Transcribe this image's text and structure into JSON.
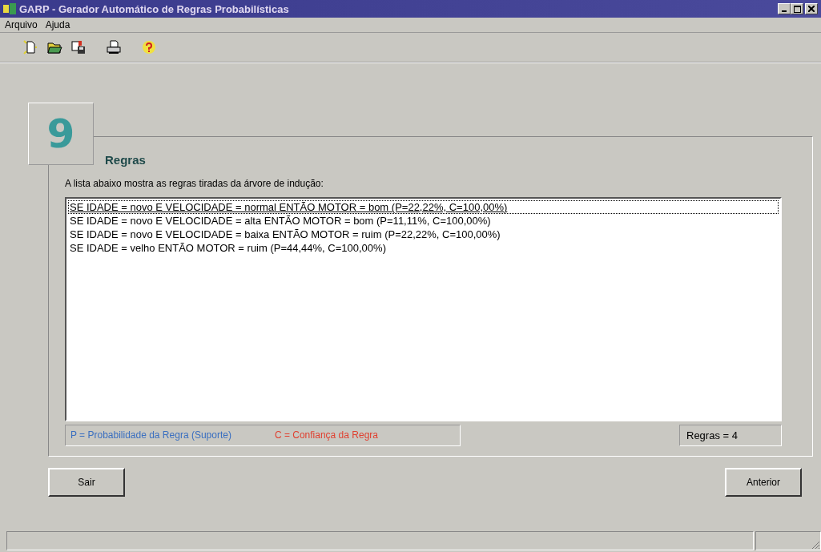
{
  "window": {
    "title": "GARP - Gerador Automático de Regras Probabilísticas"
  },
  "menu": [
    "Arquivo",
    "Ajuda"
  ],
  "step": {
    "number": "9",
    "title": "Regras",
    "description": "A lista abaixo mostra as regras tiradas da árvore de indução:"
  },
  "rules": [
    {
      "text": "SE IDADE = novo E VELOCIDADE = normal ENTÃO MOTOR = bom (P=22,22%,  C=100,00%)",
      "selected": true
    },
    {
      "text": "SE IDADE = novo E VELOCIDADE = alta ENTÃO MOTOR = bom (P=11,11%,  C=100,00%)",
      "selected": false
    },
    {
      "text": "SE IDADE = novo E VELOCIDADE = baixa ENTÃO MOTOR = ruim (P=22,22%,  C=100,00%)",
      "selected": false
    },
    {
      "text": "SE IDADE = velho ENTÃO MOTOR = ruim (P=44,44%,  C=100,00%)",
      "selected": false
    }
  ],
  "legend": [
    {
      "text": "P = Probabilidade da Regra (Suporte)",
      "color": "#3a6fc0"
    },
    {
      "text": "C = Confiança da Regra",
      "color": "#e04030"
    }
  ],
  "count": "Regras = 4",
  "buttons": {
    "left": "Sair",
    "right": "Anterior"
  }
}
